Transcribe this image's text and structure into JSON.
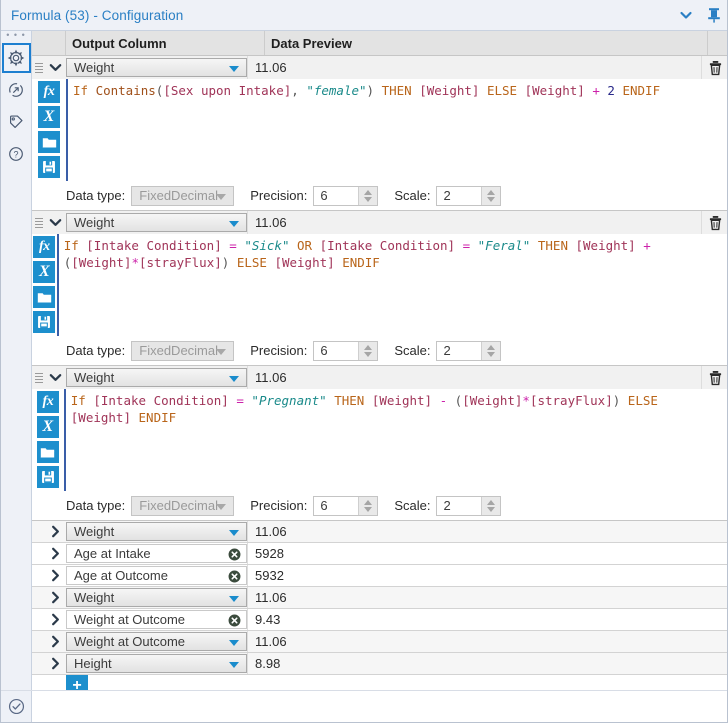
{
  "window": {
    "title": "Formula (53) - Configuration",
    "collapse_icon": "chevron-down-icon",
    "pin_icon": "pin-icon"
  },
  "rail": {
    "items": [
      {
        "name": "configuration",
        "icon": "gear-icon",
        "selected": true
      },
      {
        "name": "output",
        "icon": "arrow-circle-icon",
        "selected": false
      },
      {
        "name": "annotation",
        "icon": "tag-icon",
        "selected": false
      },
      {
        "name": "help",
        "icon": "question-circle-icon",
        "selected": false
      }
    ]
  },
  "status": {
    "icon": "check-circle-icon"
  },
  "grid": {
    "headers": {
      "output_column": "Output Column",
      "data_preview": "Data Preview"
    }
  },
  "formula_blocks": [
    {
      "output_column": "Weight",
      "data_preview": "11.06",
      "delete_icon": "trash-icon",
      "tools": [
        "fx-icon",
        "clear-x-icon",
        "open-folder-icon",
        "save-disk-icon"
      ],
      "expression_tokens": [
        {
          "t": "If ",
          "c": "k"
        },
        {
          "t": "Contains",
          "c": "fn"
        },
        {
          "t": "(",
          "c": "pn"
        },
        {
          "t": "[Sex upon Intake]",
          "c": "fi"
        },
        {
          "t": ", ",
          "c": "pn"
        },
        {
          "t": "\"female\"",
          "c": "st"
        },
        {
          "t": ")",
          "c": "pn"
        },
        {
          "t": " THEN ",
          "c": "k"
        },
        {
          "t": "[Weight]",
          "c": "fi"
        },
        {
          "t": " ELSE ",
          "c": "k"
        },
        {
          "t": "[Weight]",
          "c": "fi"
        },
        {
          "t": " ",
          "c": "pn"
        },
        {
          "t": "+",
          "c": "op"
        },
        {
          "t": " ",
          "c": "pn"
        },
        {
          "t": "2",
          "c": "nm"
        },
        {
          "t": " ENDIF",
          "c": "k"
        }
      ],
      "data_type": {
        "label": "Data type:",
        "value": "FixedDecimal",
        "disabled": true
      },
      "precision": {
        "label": "Precision:",
        "value": "6"
      },
      "scale": {
        "label": "Scale:",
        "value": "2"
      }
    },
    {
      "output_column": "Weight",
      "data_preview": "11.06",
      "delete_icon": "trash-icon",
      "tools": [
        "fx-icon",
        "clear-x-icon",
        "open-folder-icon",
        "save-disk-icon"
      ],
      "expression_tokens": [
        {
          "t": "If ",
          "c": "k"
        },
        {
          "t": "[Intake Condition]",
          "c": "fi"
        },
        {
          "t": " ",
          "c": "pn"
        },
        {
          "t": "=",
          "c": "op"
        },
        {
          "t": " ",
          "c": "pn"
        },
        {
          "t": "\"Sick\"",
          "c": "st"
        },
        {
          "t": " OR ",
          "c": "k"
        },
        {
          "t": "[Intake Condition]",
          "c": "fi"
        },
        {
          "t": " ",
          "c": "pn"
        },
        {
          "t": "=",
          "c": "op"
        },
        {
          "t": " ",
          "c": "pn"
        },
        {
          "t": "\"Feral\"",
          "c": "st"
        },
        {
          "t": " THEN ",
          "c": "k"
        },
        {
          "t": "[Weight]",
          "c": "fi"
        },
        {
          "t": " ",
          "c": "pn"
        },
        {
          "t": "+",
          "c": "op"
        },
        {
          "t": " (",
          "c": "pn"
        },
        {
          "t": "[Weight]",
          "c": "fi"
        },
        {
          "t": "*",
          "c": "op"
        },
        {
          "t": "[strayFlux]",
          "c": "fi"
        },
        {
          "t": ")",
          "c": "pn"
        },
        {
          "t": " ELSE ",
          "c": "k"
        },
        {
          "t": "[Weight]",
          "c": "fi"
        },
        {
          "t": " ENDIF",
          "c": "k"
        }
      ],
      "data_type": {
        "label": "Data type:",
        "value": "FixedDecimal",
        "disabled": true
      },
      "precision": {
        "label": "Precision:",
        "value": "6"
      },
      "scale": {
        "label": "Scale:",
        "value": "2"
      }
    },
    {
      "output_column": "Weight",
      "data_preview": "11.06",
      "delete_icon": "trash-icon",
      "tools": [
        "fx-icon",
        "clear-x-icon",
        "open-folder-icon",
        "save-disk-icon"
      ],
      "expression_tokens": [
        {
          "t": "If ",
          "c": "k"
        },
        {
          "t": "[Intake Condition]",
          "c": "fi"
        },
        {
          "t": " ",
          "c": "pn"
        },
        {
          "t": "=",
          "c": "op"
        },
        {
          "t": " ",
          "c": "pn"
        },
        {
          "t": "\"Pregnant\"",
          "c": "st"
        },
        {
          "t": " THEN ",
          "c": "k"
        },
        {
          "t": "[Weight]",
          "c": "fi"
        },
        {
          "t": " ",
          "c": "pn"
        },
        {
          "t": "-",
          "c": "op"
        },
        {
          "t": " (",
          "c": "pn"
        },
        {
          "t": "[Weight]",
          "c": "fi"
        },
        {
          "t": "*",
          "c": "op"
        },
        {
          "t": "[strayFlux]",
          "c": "fi"
        },
        {
          "t": ")",
          "c": "pn"
        },
        {
          "t": " ELSE ",
          "c": "k"
        },
        {
          "t": "[Weight]",
          "c": "fi"
        },
        {
          "t": " ENDIF",
          "c": "k"
        }
      ],
      "data_type": {
        "label": "Data type:",
        "value": "FixedDecimal",
        "disabled": true
      },
      "precision": {
        "label": "Precision:",
        "value": "6"
      },
      "scale": {
        "label": "Scale:",
        "value": "2"
      }
    }
  ],
  "collapsed_rows": [
    {
      "output_column": "Weight",
      "data_preview": "11.06",
      "state": "dropdown"
    },
    {
      "output_column": "Age at Intake",
      "data_preview": "5928",
      "state": "error"
    },
    {
      "output_column": "Age at Outcome",
      "data_preview": "5932",
      "state": "error"
    },
    {
      "output_column": "Weight",
      "data_preview": "11.06",
      "state": "dropdown"
    },
    {
      "output_column": "Weight at Outcome",
      "data_preview": "9.43",
      "state": "error"
    },
    {
      "output_column": "Weight at Outcome",
      "data_preview": "11.06",
      "state": "dropdown"
    },
    {
      "output_column": "Height",
      "data_preview": "8.98",
      "state": "dropdown"
    }
  ],
  "add_button": {
    "label": "+",
    "icon": "plus-icon"
  },
  "colors": {
    "accent_blue": "#1d8fcd",
    "title_blue": "#2a7fc4",
    "rail_bg": "#eef1f7",
    "header_bg": "#e3e3e3",
    "keyword": "#b9651a",
    "field": "#a03458",
    "string": "#1a8a8a",
    "operator": "#cc22aa",
    "number": "#2a2a8a"
  }
}
